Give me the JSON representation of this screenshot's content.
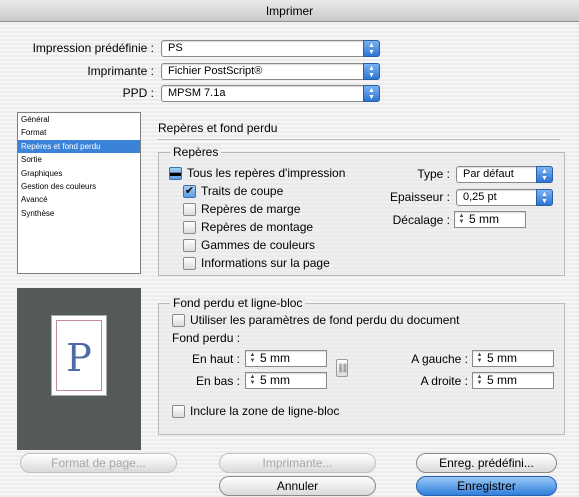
{
  "window": {
    "title": "Imprimer"
  },
  "top": {
    "preset_label": "Impression prédéfinie :",
    "preset_value": "PS",
    "printer_label": "Imprimante :",
    "printer_value": "Fichier PostScript®",
    "ppd_label": "PPD :",
    "ppd_value": "MPSM 7.1a"
  },
  "sidebar": {
    "items": [
      "Général",
      "Format",
      "Repères et fond perdu",
      "Sortie",
      "Graphiques",
      "Gestion des couleurs",
      "Avancé",
      "Synthèse"
    ],
    "selected_index": 2
  },
  "main": {
    "heading": "Repères et fond perdu",
    "marks": {
      "title": "Repères",
      "all_marks": "Tous les repères d'impression",
      "trim_marks": "Traits de coupe",
      "margin_marks": "Repères de marge",
      "registration_marks": "Repères de montage",
      "color_bars": "Gammes de couleurs",
      "page_info": "Informations sur la page",
      "type_label": "Type :",
      "type_value": "Par défaut",
      "weight_label": "Epaisseur :",
      "weight_value": "0,25 pt",
      "offset_label": "Décalage :",
      "offset_value": "5 mm"
    },
    "bleed": {
      "title": "Fond perdu et ligne-bloc",
      "use_doc": "Utiliser les paramètres de fond perdu du document",
      "bleed_label": "Fond perdu :",
      "top_label": "En haut :",
      "top_value": "5 mm",
      "bottom_label": "En bas :",
      "bottom_value": "5 mm",
      "left_label": "A gauche :",
      "left_value": "5 mm",
      "right_label": "A droite :",
      "right_value": "5 mm",
      "slug": "Inclure la zone de ligne-bloc"
    }
  },
  "preview": {
    "letter": "P"
  },
  "buttons": {
    "page_setup": "Format de page...",
    "printer": "Imprimante...",
    "save_preset": "Enreg. prédéfini...",
    "cancel": "Annuler",
    "save": "Enregistrer"
  },
  "icons": {
    "popup": "up-down-arrows-icon",
    "stepper": "stepper-icon",
    "link": "chain-link-icon",
    "check": "checkmark-icon",
    "mixed": "dash-icon"
  }
}
